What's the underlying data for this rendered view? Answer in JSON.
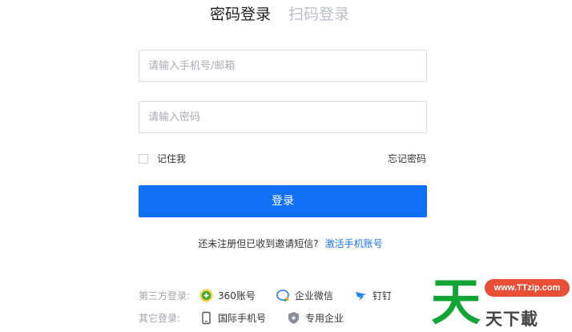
{
  "tabs": [
    {
      "label": "密码登录",
      "active": true
    },
    {
      "label": "扫码登录",
      "active": false
    }
  ],
  "form": {
    "account_placeholder": "请输入手机号/邮箱",
    "account_value": "",
    "password_placeholder": "请输入密码",
    "password_value": "",
    "remember_label": "记住我",
    "remember_checked": false,
    "forgot_label": "忘记密码",
    "submit_label": "登录"
  },
  "invite": {
    "text": "还未注册但已收到邀请短信?",
    "link": "激活手机账号"
  },
  "third_party": {
    "label": "第三方登录:",
    "options": [
      {
        "label": "360账号",
        "icon": "360-icon"
      },
      {
        "label": "企业微信",
        "icon": "wecom-icon"
      },
      {
        "label": "钉钉",
        "icon": "dingtalk-icon"
      }
    ]
  },
  "other_login": {
    "label": "其它登录:",
    "options": [
      {
        "label": "国际手机号",
        "icon": "phone-icon"
      },
      {
        "label": "专用企业",
        "icon": "enterprise-icon"
      }
    ]
  },
  "watermark": {
    "url": "www.TTzip.com",
    "text": "天下載",
    "big_char": "天"
  },
  "colors": {
    "primary": "#0f6ff5",
    "link": "#1a73e8",
    "watermark_green": "#13a436",
    "watermark_red": "#e94e36"
  }
}
